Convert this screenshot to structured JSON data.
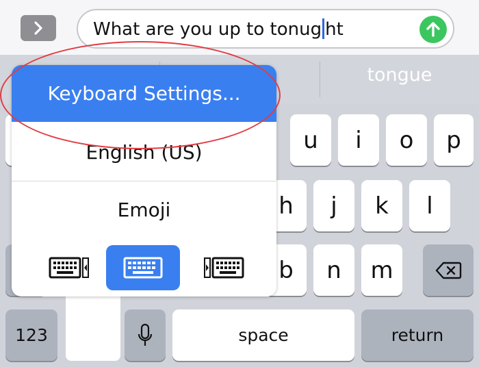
{
  "input_bar": {
    "text_before_caret": "What are you up to tonug",
    "text_after_caret": "ht",
    "expand_icon": "chevron-right-icon",
    "send_icon": "arrow-up-icon",
    "send_color": "#3cc65f"
  },
  "suggestions": {
    "word": "tongue"
  },
  "popup_menu": {
    "items": [
      {
        "label": "Keyboard Settings...",
        "selected": true
      },
      {
        "label": "English (US)",
        "selected": false
      },
      {
        "label": "Emoji",
        "selected": false
      }
    ],
    "layout_modes": [
      {
        "icon": "keyboard-left-icon",
        "active": false
      },
      {
        "icon": "keyboard-full-icon",
        "active": true
      },
      {
        "icon": "keyboard-right-icon",
        "active": false
      }
    ],
    "accent_color": "#3a7ff0"
  },
  "keyboard": {
    "row1": [
      "u",
      "i",
      "o",
      "p"
    ],
    "row2": [
      "h",
      "j",
      "k",
      "l"
    ],
    "row3": [
      "b",
      "n",
      "m"
    ],
    "delete_icon": "backspace-icon",
    "numbers_label": "123",
    "mic_icon": "microphone-icon",
    "space_label": "space",
    "return_label": "return"
  },
  "annotation": {
    "color": "#e03c43"
  }
}
